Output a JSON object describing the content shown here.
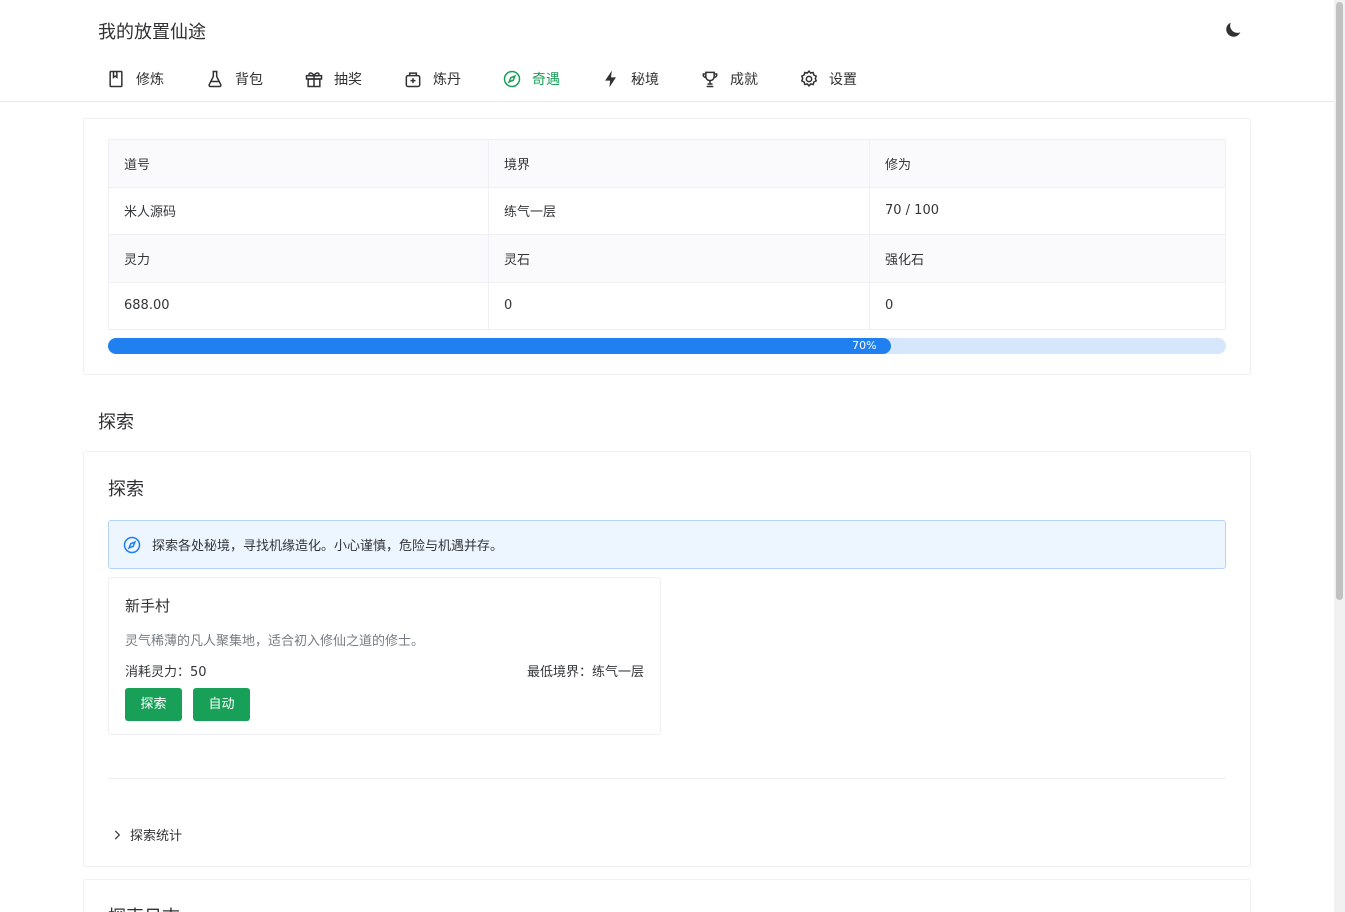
{
  "app": {
    "title": "我的放置仙途"
  },
  "nav": {
    "active_color": "#18a058",
    "items": [
      {
        "label": "修炼",
        "icon": "book-icon"
      },
      {
        "label": "背包",
        "icon": "flask-icon"
      },
      {
        "label": "抽奖",
        "icon": "gift-icon"
      },
      {
        "label": "炼丹",
        "icon": "cauldron-icon"
      },
      {
        "label": "奇遇",
        "icon": "compass-icon",
        "active": true
      },
      {
        "label": "秘境",
        "icon": "lightning-icon"
      },
      {
        "label": "成就",
        "icon": "trophy-icon"
      },
      {
        "label": "设置",
        "icon": "gear-icon"
      }
    ]
  },
  "status": {
    "headers1": [
      "道号",
      "境界",
      "修为"
    ],
    "values1": [
      "米人源码",
      "练气一层",
      "70 / 100"
    ],
    "headers2": [
      "灵力",
      "灵石",
      "强化石"
    ],
    "values2": [
      "688.00",
      "0",
      "0"
    ],
    "progress_percent": 70,
    "progress_label": "70%",
    "progress_color": "#2080f0"
  },
  "section_title": "探索",
  "explore": {
    "title": "探索",
    "alert_text": "探索各处秘境，寻找机缘造化。小心谨慎，危险与机遇并存。",
    "location": {
      "name": "新手村",
      "description": "灵气稀薄的凡人聚集地，适合初入修仙之道的修士。",
      "cost": "消耗灵力：50",
      "requirement": "最低境界：练气一层",
      "explore_button": "探索",
      "auto_button": "自动"
    },
    "stats_toggle": "探索统计"
  },
  "log": {
    "title": "探索日志"
  }
}
